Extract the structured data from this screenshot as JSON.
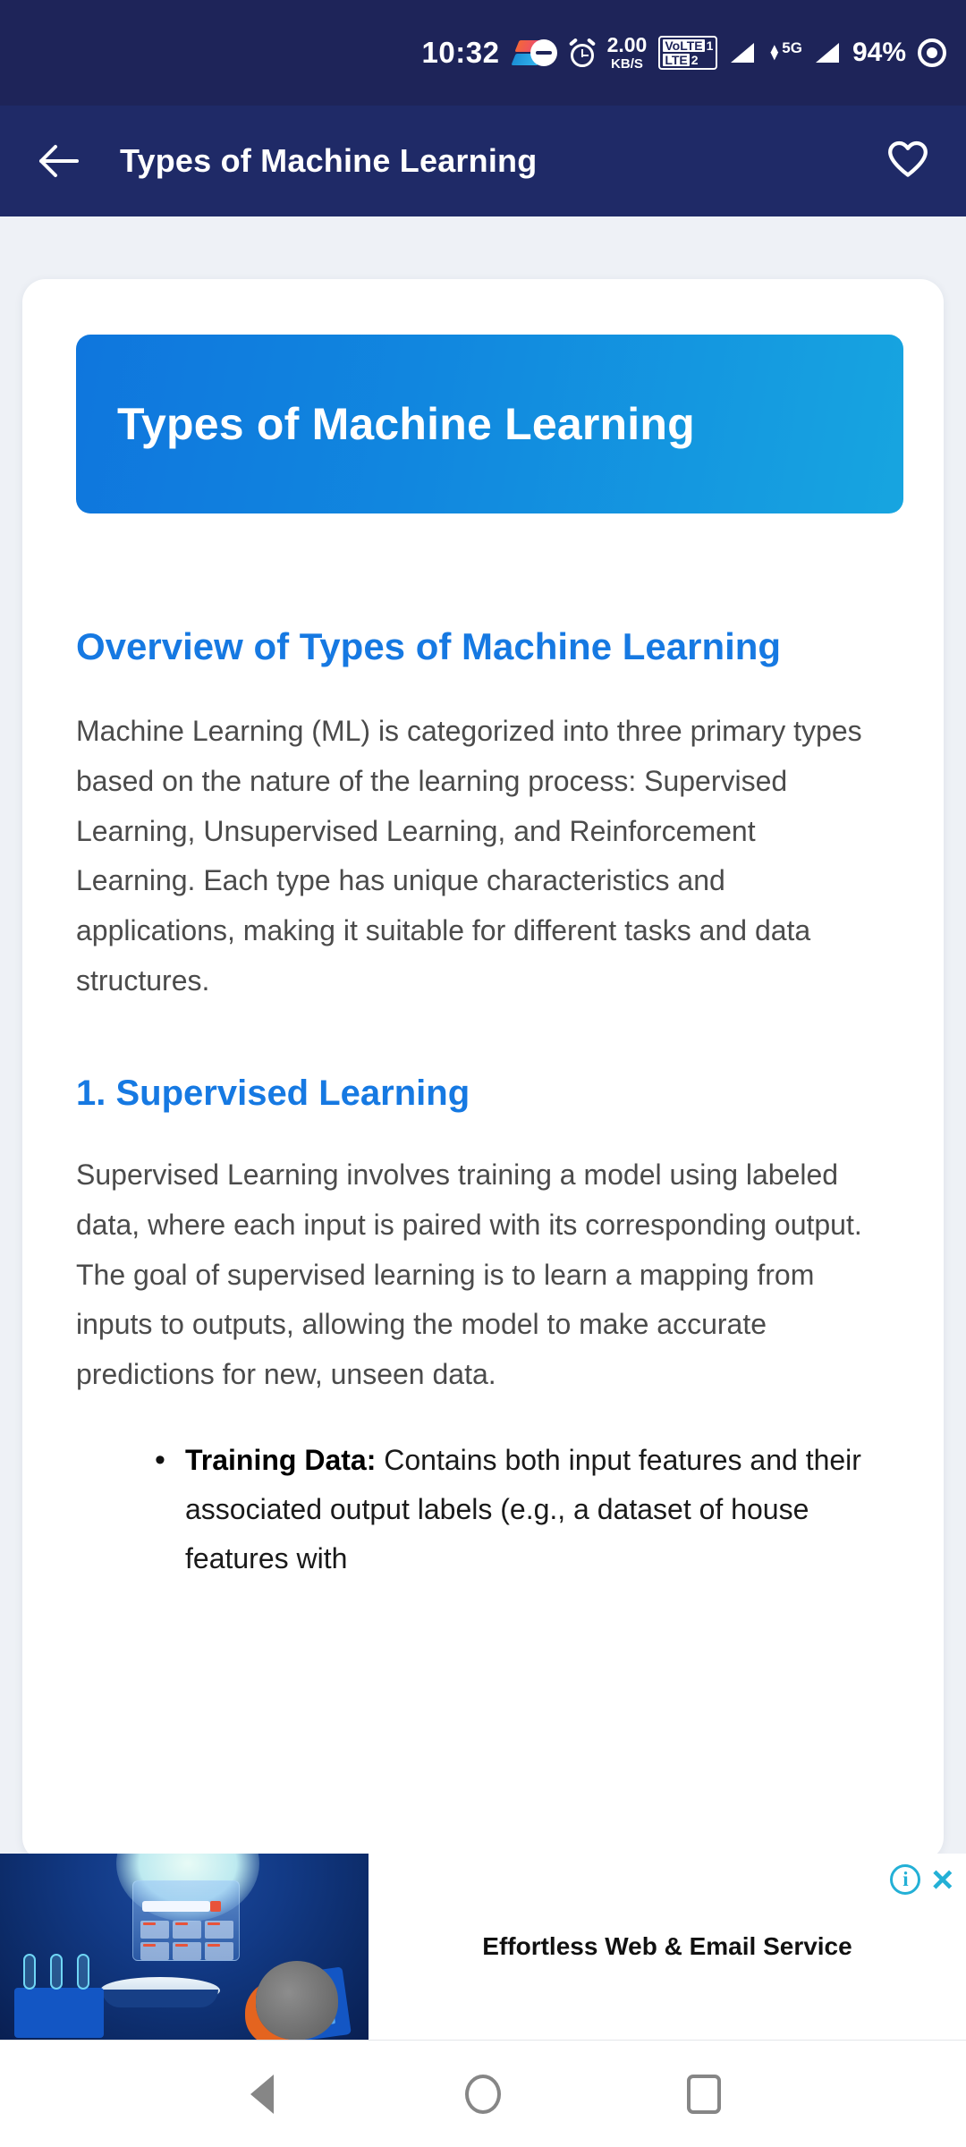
{
  "status_bar": {
    "time": "10:32",
    "app_logo_icon": "app-logo-icon",
    "dnd_icon": "do-not-disturb-icon",
    "alarm_icon": "alarm-icon",
    "network_speed_value": "2.00",
    "network_speed_unit": "KB/S",
    "volte_label": "VoLTE",
    "sim1_label": "1",
    "sim2_label": "2",
    "network_type": "5G",
    "battery_percent": "94%",
    "screen_record_icon": "screen-record-icon"
  },
  "app_bar": {
    "back_icon": "back-arrow-icon",
    "title": "Types of Machine Learning",
    "favorite_icon": "heart-icon"
  },
  "content": {
    "banner_title": "Types of Machine Learning",
    "overview_heading": "Overview of Types of Machine Learning",
    "overview_paragraph": "Machine Learning (ML) is categorized into three primary types based on the nature of the learning process: Supervised Learning, Unsupervised Learning, and Reinforcement Learning. Each type has unique characteristics and applications, making it suitable for different tasks and data structures.",
    "section1_heading": "1. Supervised Learning",
    "section1_paragraph": "Supervised Learning involves training a model using labeled data, where each input is paired with its corresponding output. The goal of supervised learning is to learn a mapping from inputs to outputs, allowing the model to make accurate predictions for new, unseen data.",
    "bullets": [
      {
        "term": "Training Data:",
        "text": " Contains both input features and their associated output labels (e.g., a dataset of house features with"
      }
    ]
  },
  "ad": {
    "headline": "Effortless Web & Email Service",
    "info_icon": "ad-info-icon",
    "info_glyph": "i",
    "close_icon": "ad-close-icon",
    "close_glyph": "×",
    "image_alt": "ad-illustration"
  },
  "nav_bar": {
    "back_icon": "nav-back-icon",
    "home_icon": "nav-home-icon",
    "recents_icon": "nav-recents-icon"
  },
  "colors": {
    "status_bar_bg": "#1e2459",
    "app_bar_bg": "#1f2a67",
    "page_bg": "#eef1f6",
    "accent_blue": "#1679e2",
    "banner_gradient_start": "#0f76dd",
    "banner_gradient_end": "#17a5e0",
    "body_text": "#4b4b4b",
    "ad_accent": "#23b0d6"
  }
}
